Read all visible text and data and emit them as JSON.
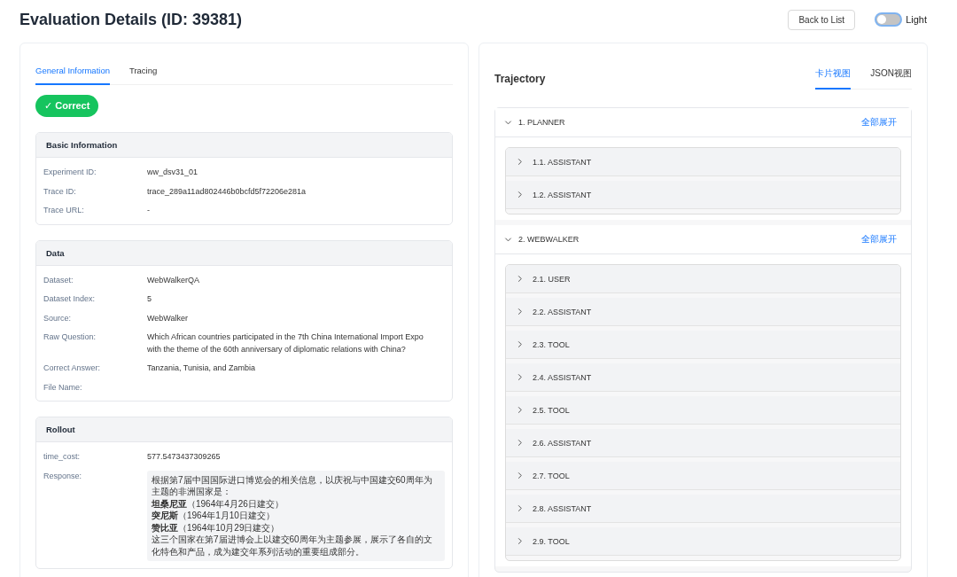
{
  "page": {
    "title": "Evaluation Details (ID: 39381)",
    "back_button": "Back to List",
    "theme_toggle": {
      "on": false,
      "label": "Light"
    }
  },
  "left_panel": {
    "tabs": [
      {
        "label": "General Information",
        "selected": true
      },
      {
        "label": "Tracing",
        "selected": false
      }
    ],
    "status_badge": {
      "label": "✓ Correct",
      "kind": "correct"
    },
    "sections": [
      {
        "title": "Basic Information",
        "fields": [
          {
            "label": "Experiment ID:",
            "value": "ww_dsv31_01"
          },
          {
            "label": "Trace ID:",
            "value": "trace_289a11ad802446b0bcfd5f72206e281a"
          },
          {
            "label": "Trace URL:",
            "value": "-"
          }
        ]
      },
      {
        "title": "Data",
        "fields": [
          {
            "label": "Dataset:",
            "value": "WebWalkerQA"
          },
          {
            "label": "Dataset Index:",
            "value": "5"
          },
          {
            "label": "Source:",
            "value": "WebWalker"
          },
          {
            "label": "Raw Question:",
            "value": "Which African countries participated in the 7th China International Import Expo with the theme of the 60th anniversary of diplomatic relations with China?"
          },
          {
            "label": "Correct Answer:",
            "value": "Tanzania, Tunisia, and Zambia"
          },
          {
            "label": "File Name:"
          }
        ]
      },
      {
        "title": "Rollout",
        "fields": [
          {
            "label": "time_cost:",
            "value": "577.5473437309265"
          },
          {
            "label": "Response:",
            "kind": "block",
            "lines": [
              "根据第7届中国国际进口博览会的相关信息，以庆祝与中国建交60周年为主题的非洲国家是：",
              "**坦桑尼亚**（1964年4月26日建交）",
              "**突尼斯**（1964年1月10日建交）",
              "**赞比亚**（1964年10月29日建交）",
              "这三个国家在第7届进博会上以建交60周年为主题参展，展示了各自的文化特色和产品，成为建交年系列活动的重要组成部分。"
            ]
          }
        ]
      }
    ]
  },
  "right_panel": {
    "title": "Trajectory",
    "tabs": [
      {
        "label": "卡片视图",
        "selected": true
      },
      {
        "label": "JSON视图",
        "selected": false
      }
    ],
    "groups": [
      {
        "label": "1. PLANNER",
        "expanded": true,
        "action": "全部展开",
        "children": [
          {
            "label": "1.1. ASSISTANT",
            "expanded": false
          },
          {
            "label": "1.2. ASSISTANT",
            "expanded": false
          }
        ]
      },
      {
        "label": "2. WEBWALKER",
        "expanded": true,
        "action": "全部展开",
        "children": [
          {
            "label": "2.1. USER",
            "expanded": false
          },
          {
            "label": "2.2. ASSISTANT",
            "expanded": false
          },
          {
            "label": "2.3. TOOL",
            "expanded": false
          },
          {
            "label": "2.4. ASSISTANT",
            "expanded": false
          },
          {
            "label": "2.5. TOOL",
            "expanded": false
          },
          {
            "label": "2.6. ASSISTANT",
            "expanded": false
          },
          {
            "label": "2.7. TOOL",
            "expanded": false
          },
          {
            "label": "2.8. ASSISTANT",
            "expanded": false
          },
          {
            "label": "2.9. TOOL",
            "expanded": false
          }
        ]
      }
    ]
  }
}
